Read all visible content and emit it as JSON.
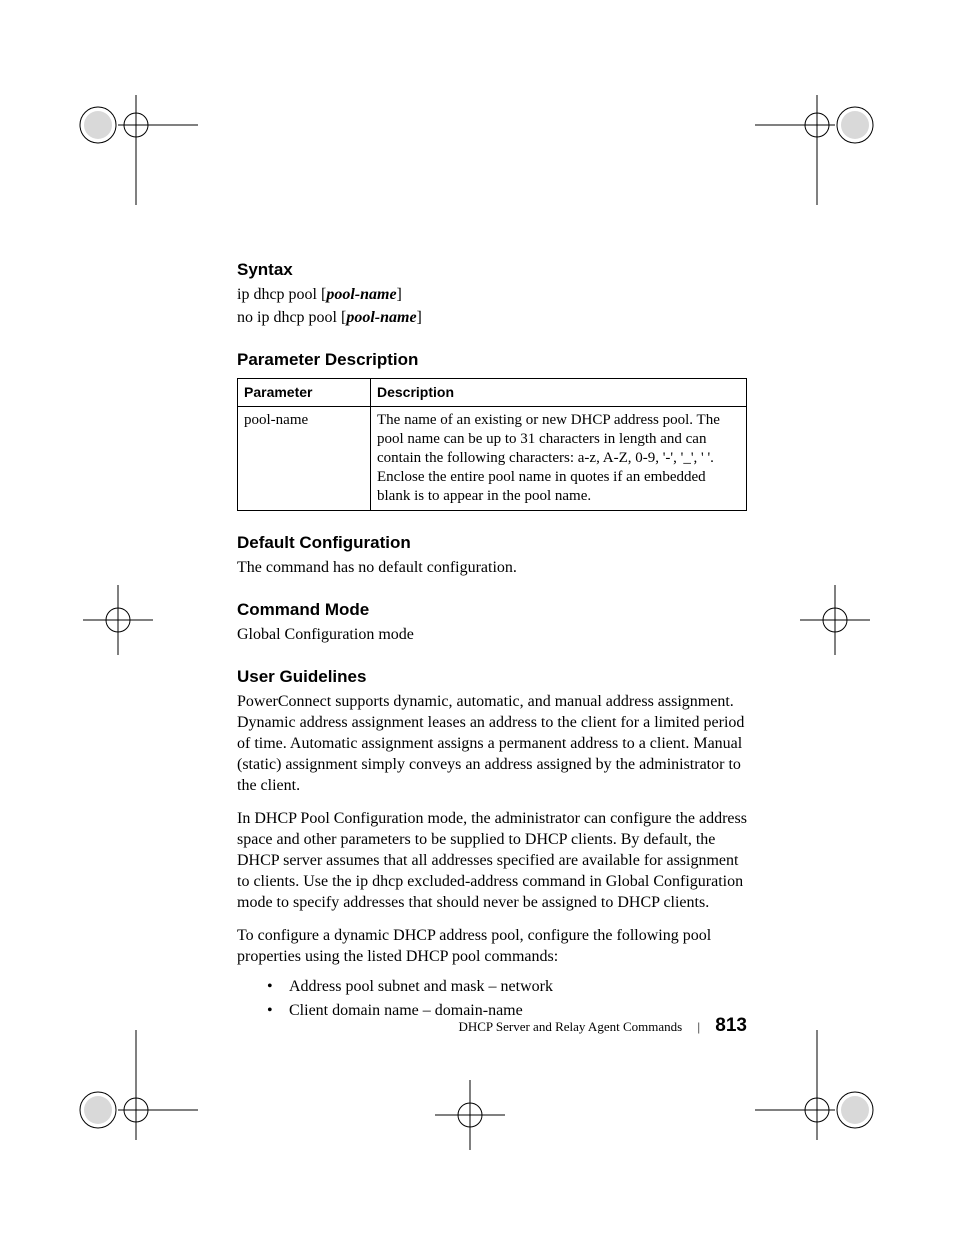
{
  "headings": {
    "syntax": "Syntax",
    "param_desc": "Parameter Description",
    "default_cfg": "Default Configuration",
    "cmd_mode": "Command Mode",
    "user_guidelines": "User Guidelines"
  },
  "syntax": {
    "line1_a": "ip dhcp pool [",
    "line1_b": "pool-name",
    "line1_c": "]",
    "line2_a": "no ip dhcp pool [",
    "line2_b": "pool-name",
    "line2_c": "]"
  },
  "table": {
    "col1": "Parameter",
    "col2": "Description",
    "rows": [
      {
        "param": "pool-name",
        "desc": "The name of an existing or new DHCP address pool. The pool name can be up to 31 characters in length and can contain the following characters: a-z, A-Z, 0-9, '-', '_', ' '. Enclose the entire pool name in quotes if an embedded blank is to appear in the pool name."
      }
    ]
  },
  "default_cfg_body": "The command has no default configuration.",
  "cmd_mode_body": "Global Configuration mode",
  "guidelines": {
    "p1": "PowerConnect supports dynamic, automatic, and manual address assignment. Dynamic address assignment leases an address to the client for a limited period of time. Automatic assignment assigns a permanent address to a client. Manual (static) assignment simply conveys an address assigned by the administrator to the client.",
    "p2": "In DHCP Pool Configuration mode, the administrator can configure the address space and other parameters to be supplied to DHCP clients. By default, the DHCP server assumes that all addresses specified are available for assignment to clients. Use the ip dhcp excluded-address command in Global Configuration mode to specify addresses that should never be assigned to DHCP clients.",
    "p3": "To configure a dynamic DHCP address pool, configure the following pool properties using the listed DHCP pool commands:",
    "bullets": [
      "Address pool subnet and mask – network",
      "Client domain name – domain-name"
    ]
  },
  "footer": {
    "chapter": "DHCP Server and Relay Agent Commands",
    "page": "813"
  }
}
